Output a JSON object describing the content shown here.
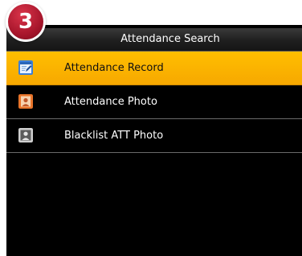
{
  "step_badge": "3",
  "header": {
    "title": "Attendance Search"
  },
  "menu": {
    "items": [
      {
        "label": "Attendance Record",
        "icon": "notepad-pen-icon",
        "selected": true
      },
      {
        "label": "Attendance Photo",
        "icon": "person-photo-icon",
        "selected": false
      },
      {
        "label": "Blacklist ATT Photo",
        "icon": "person-silhouette-icon",
        "selected": false
      }
    ]
  },
  "colors": {
    "selected_background": "#FFB400",
    "screen_background": "#000000",
    "badge": "#A8162C"
  }
}
